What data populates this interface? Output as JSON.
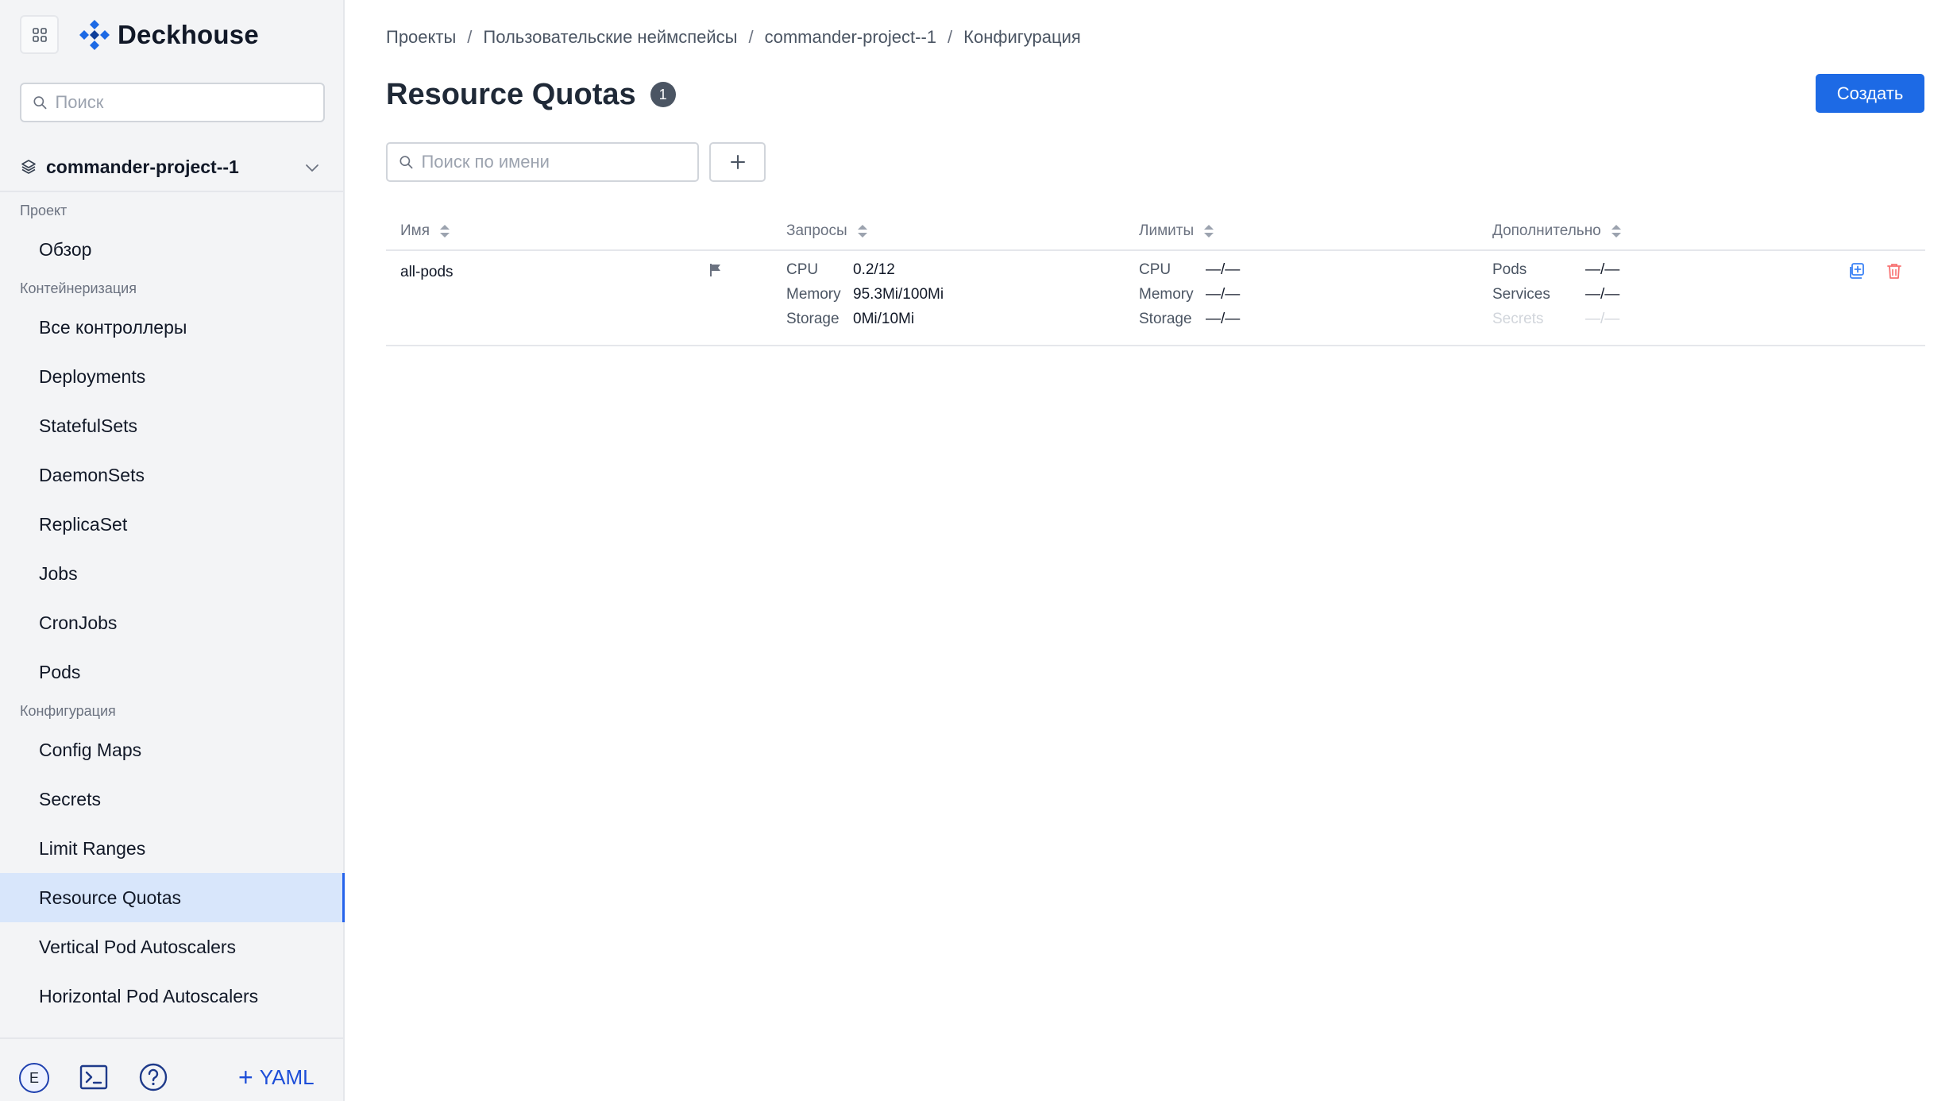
{
  "app": {
    "logo_text": "Deckhouse",
    "brand_color": "#1d6ae5"
  },
  "sidebar": {
    "search_placeholder": "Поиск",
    "project_name": "commander-project--1",
    "sections": [
      {
        "title": "Проект",
        "items": [
          "Обзор"
        ]
      },
      {
        "title": "Контейнеризация",
        "items": [
          "Все контроллеры",
          "Deployments",
          "StatefulSets",
          "DaemonSets",
          "ReplicaSet",
          "Jobs",
          "CronJobs",
          "Pods"
        ]
      },
      {
        "title": "Конфигурация",
        "items": [
          "Config Maps",
          "Secrets",
          "Limit Ranges",
          "Resource Quotas",
          "Vertical Pod Autoscalers",
          "Horizontal Pod Autoscalers"
        ]
      }
    ],
    "active_item": "Resource Quotas",
    "footer": {
      "avatar_letter": "E",
      "yaml_label": "YAML"
    }
  },
  "breadcrumb": [
    "Проекты",
    "Пользовательские неймспейсы",
    "commander-project--1",
    "Конфигурация"
  ],
  "page": {
    "title": "Resource Quotas",
    "count": "1",
    "create_label": "Создать",
    "search_placeholder": "Поиск по имени"
  },
  "table": {
    "columns": [
      "Имя",
      "Запросы",
      "Лимиты",
      "Дополнительно"
    ],
    "rows": [
      {
        "name": "all-pods",
        "requests": [
          {
            "key": "CPU",
            "value": "0.2/12"
          },
          {
            "key": "Memory",
            "value": "95.3Mi/100Mi"
          },
          {
            "key": "Storage",
            "value": "0Mi/10Mi"
          }
        ],
        "limits": [
          {
            "key": "CPU",
            "value": "—/—"
          },
          {
            "key": "Memory",
            "value": "—/—"
          },
          {
            "key": "Storage",
            "value": "—/—"
          }
        ],
        "extra": [
          {
            "key": "Pods",
            "value": "—/—"
          },
          {
            "key": "Services",
            "value": "—/—"
          },
          {
            "key": "Secrets",
            "value": "—/—"
          }
        ]
      }
    ]
  }
}
